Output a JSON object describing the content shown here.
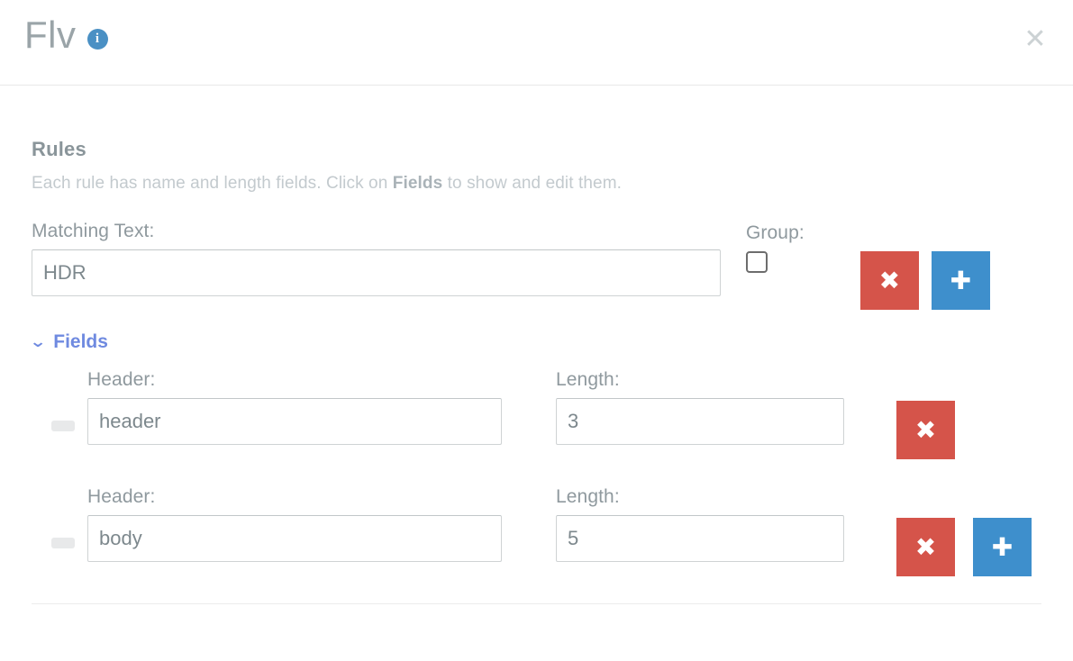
{
  "header": {
    "title": "Flv",
    "info_icon": "info-icon",
    "close_icon": "✕"
  },
  "rules_section": {
    "heading": "Rules",
    "description_prefix": "Each rule has name and length fields. Click on ",
    "description_bold": "Fields",
    "description_suffix": " to show and edit them."
  },
  "rule": {
    "matching_text_label": "Matching Text:",
    "matching_text_value": "HDR",
    "matching_text_placeholder": "Matching Text",
    "group_label": "Group:",
    "group_checked": false,
    "delete_label": "✖",
    "add_label": "✚"
  },
  "fields_toggle": {
    "chevron": "⌄",
    "label": "Fields"
  },
  "fields": {
    "header_label": "Header:",
    "length_label": "Length:",
    "header_placeholder": "Header",
    "length_placeholder": "Length",
    "delete_label": "✖",
    "add_label": "✚",
    "rows": [
      {
        "header_value": "header",
        "length_value": "3",
        "has_add": false
      },
      {
        "header_value": "body",
        "length_value": "5",
        "has_add": true
      }
    ]
  },
  "colors": {
    "danger": "#d5544a",
    "primary": "#3e8fcc",
    "link": "#6f8ae0",
    "muted_text": "#8f999e",
    "faint_text": "#c3cace"
  }
}
